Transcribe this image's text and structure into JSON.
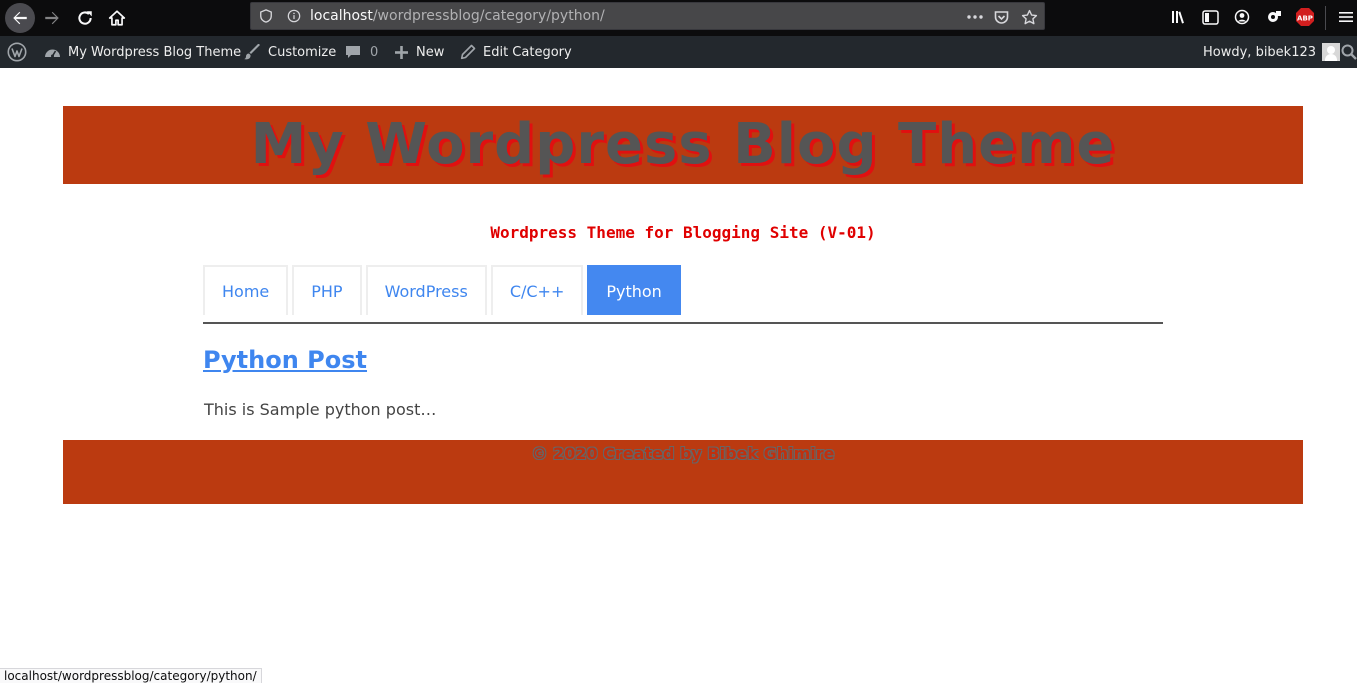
{
  "browser": {
    "url_host": "localhost",
    "url_path": "/wordpressblog/category/python/",
    "icons": [
      "back-icon",
      "forward-icon",
      "reload-icon",
      "home-icon",
      "shield-icon",
      "info-icon",
      "more-icon",
      "pocket-icon",
      "bookmark-star-icon",
      "library-icon",
      "sidebar-icon",
      "account-icon",
      "extension-icon",
      "adblock-icon",
      "menu-icon"
    ],
    "adblock_label": "ABP"
  },
  "admin_bar": {
    "site_name": "My Wordpress Blog Theme",
    "customize": "Customize",
    "comments_count": "0",
    "new": "New",
    "edit_category": "Edit Category",
    "howdy": "Howdy, bibek123"
  },
  "site": {
    "title": "My Wordpress Blog Theme",
    "tagline": "Wordpress Theme for Blogging Site (V-01)",
    "accent_color": "#bb3a10",
    "link_color": "#3f86ef"
  },
  "menu": {
    "items": [
      {
        "label": "Home",
        "active": false
      },
      {
        "label": "PHP",
        "active": false
      },
      {
        "label": "WordPress",
        "active": false
      },
      {
        "label": "C/C++",
        "active": false
      },
      {
        "label": "Python",
        "active": true
      }
    ]
  },
  "post": {
    "title": "Python Post",
    "excerpt": "This is Sample python post…"
  },
  "footer": {
    "text": "© 2020 Created by Bibek Ghimire"
  },
  "status_bar": {
    "link": "localhost/wordpressblog/category/python/"
  }
}
